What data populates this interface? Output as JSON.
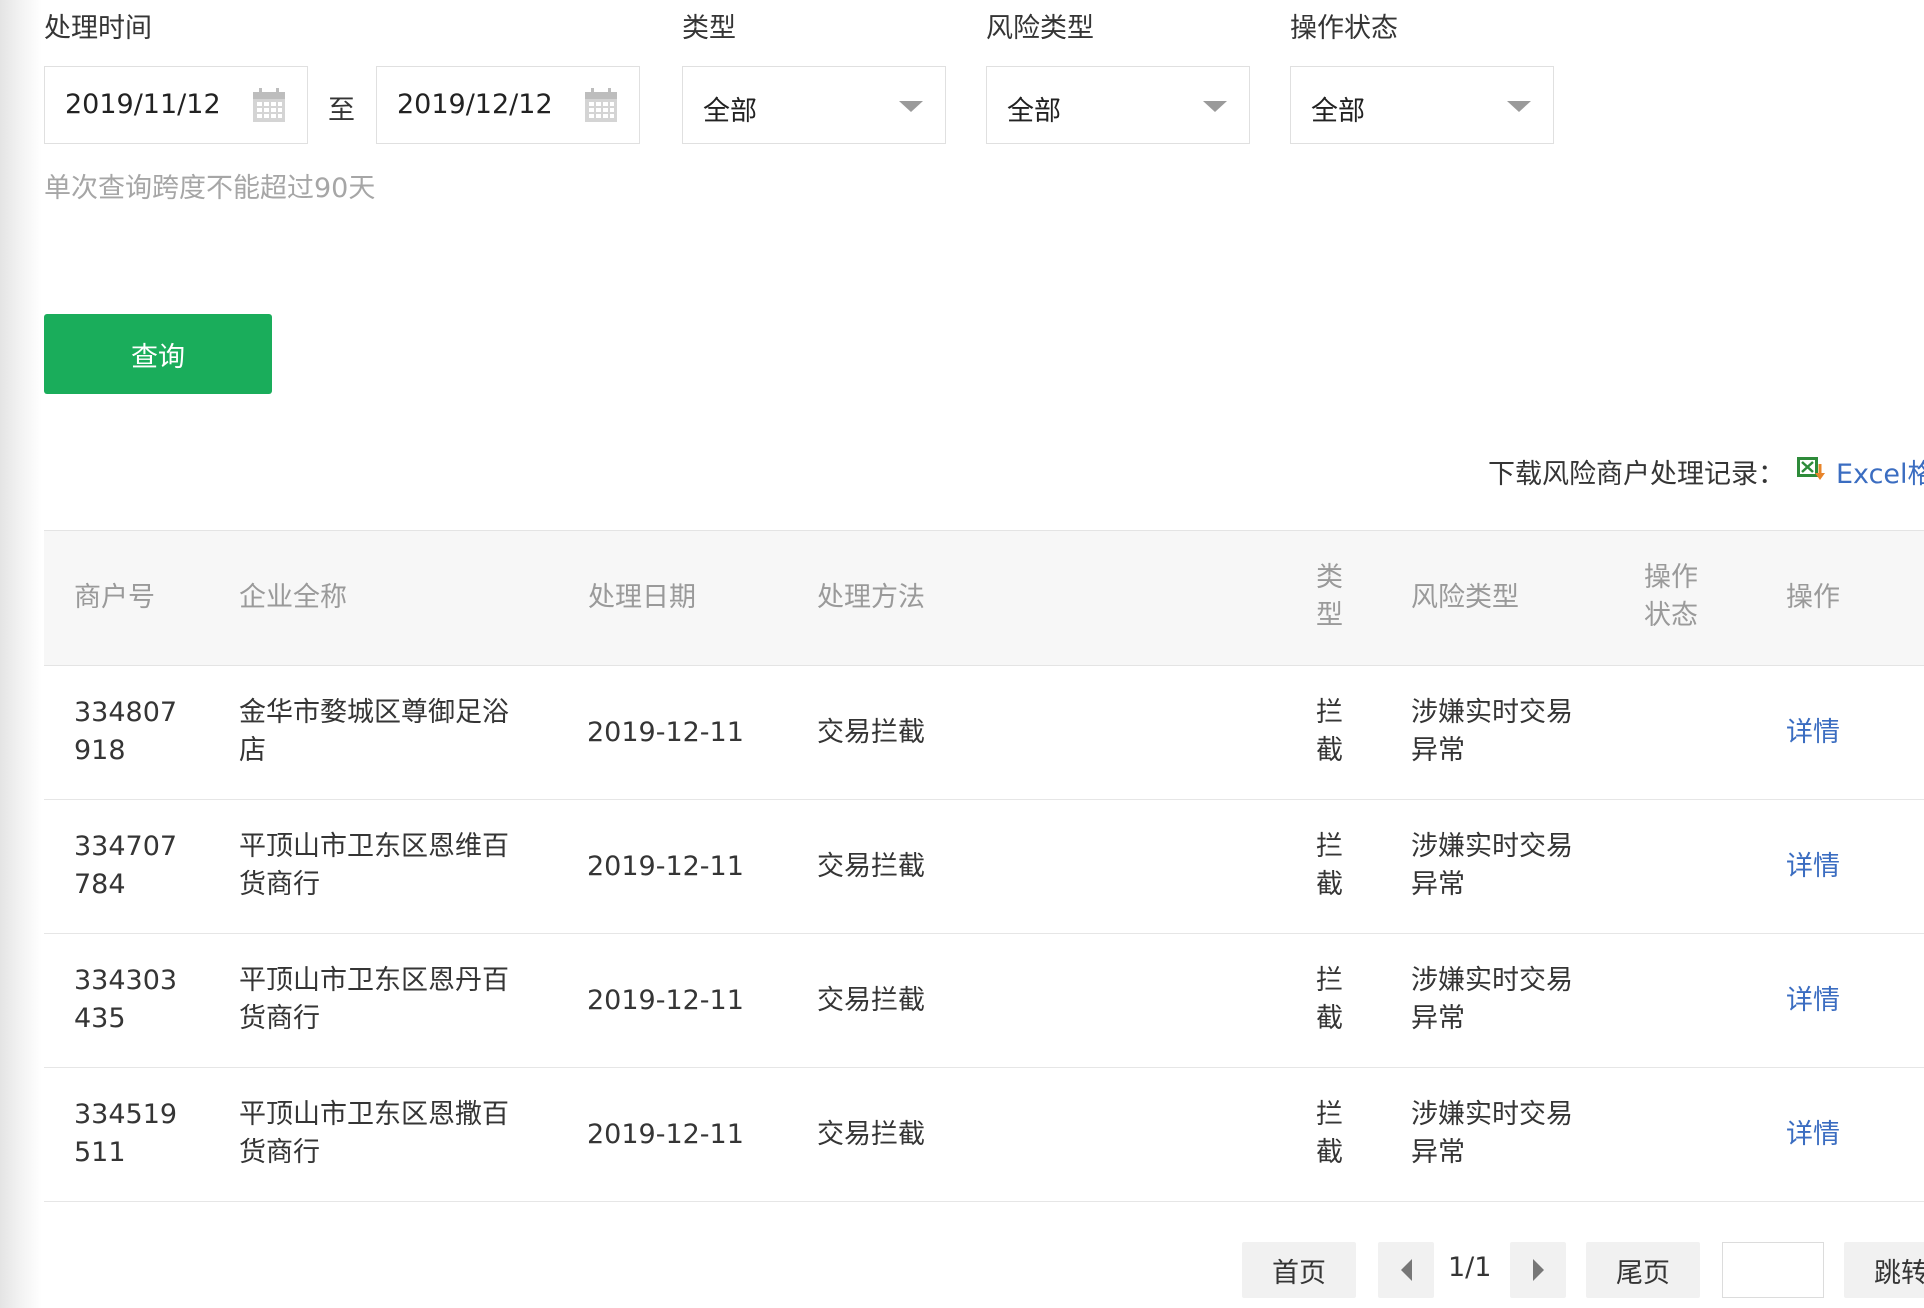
{
  "filters": {
    "time_label": "处理时间",
    "start_date": "2019/11/12",
    "to_label": "至",
    "end_date": "2019/12/12",
    "type_label": "类型",
    "type_value": "全部",
    "risk_label": "风险类型",
    "risk_value": "全部",
    "status_label": "操作状态",
    "status_value": "全部",
    "hint": "单次查询跨度不能超过90天",
    "query_button": "查询"
  },
  "download": {
    "label": "下载风险商户处理记录：",
    "link": "Excel格",
    "icon": "excel-icon"
  },
  "table": {
    "headers": {
      "merchant_id": "商户号",
      "company": "企业全称",
      "date": "处理日期",
      "method": "处理方法",
      "type_line1": "类",
      "type_line2": "型",
      "risk": "风险类型",
      "status_line1": "操作",
      "status_line2": "状态",
      "action": "操作"
    },
    "rows": [
      {
        "id_line1": "334807",
        "id_line2": "918",
        "company_line1": "金华市婺城区尊御足浴",
        "company_line2": "店",
        "date": "2019-12-11",
        "method": "交易拦截",
        "type_line1": "拦",
        "type_line2": "截",
        "risk_line1": "涉嫌实时交易",
        "risk_line2": "异常",
        "action": "详情"
      },
      {
        "id_line1": "334707",
        "id_line2": "784",
        "company_line1": "平顶山市卫东区恩维百",
        "company_line2": "货商行",
        "date": "2019-12-11",
        "method": "交易拦截",
        "type_line1": "拦",
        "type_line2": "截",
        "risk_line1": "涉嫌实时交易",
        "risk_line2": "异常",
        "action": "详情"
      },
      {
        "id_line1": "334303",
        "id_line2": "435",
        "company_line1": "平顶山市卫东区恩丹百",
        "company_line2": "货商行",
        "date": "2019-12-11",
        "method": "交易拦截",
        "type_line1": "拦",
        "type_line2": "截",
        "risk_line1": "涉嫌实时交易",
        "risk_line2": "异常",
        "action": "详情"
      },
      {
        "id_line1": "334519",
        "id_line2": "511",
        "company_line1": "平顶山市卫东区恩撒百",
        "company_line2": "货商行",
        "date": "2019-12-11",
        "method": "交易拦截",
        "type_line1": "拦",
        "type_line2": "截",
        "risk_line1": "涉嫌实时交易",
        "risk_line2": "异常",
        "action": "详情"
      }
    ]
  },
  "pagination": {
    "first": "首页",
    "page_info": "1/1",
    "last": "尾页",
    "jump": "跳转",
    "jump_value": ""
  },
  "colors": {
    "accent_green": "#1aad5b",
    "link_blue": "#3b6dc1",
    "header_bg": "#f7f7f7"
  }
}
